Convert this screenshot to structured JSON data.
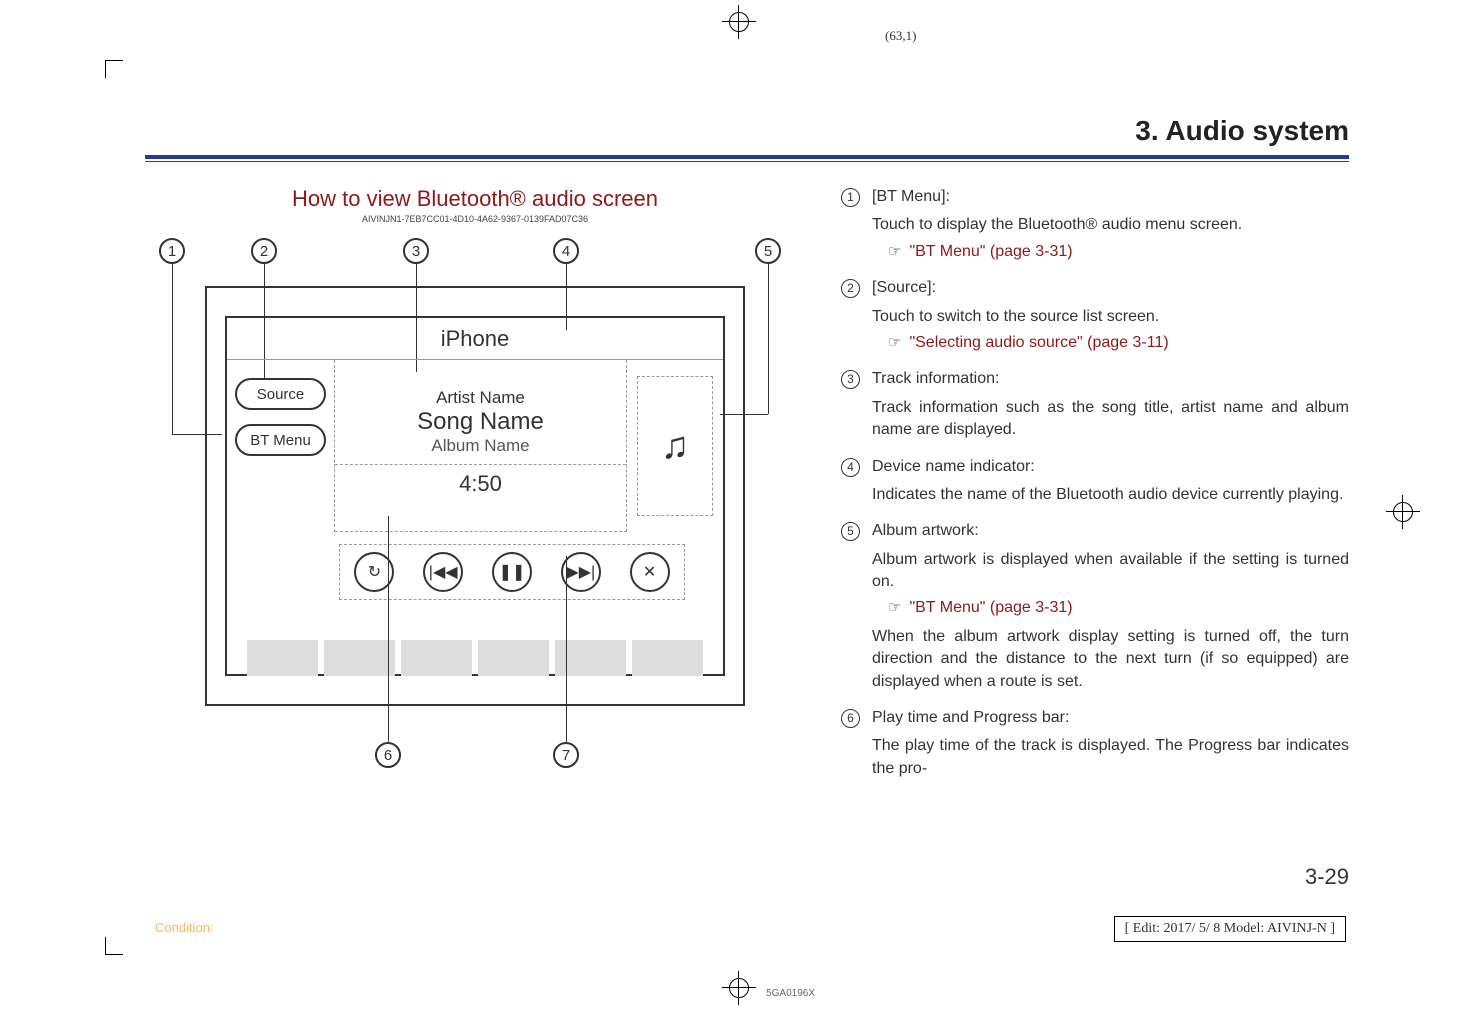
{
  "page_marker": "(63,1)",
  "chapter": "3. Audio system",
  "section_title": "How to view Bluetooth® audio screen",
  "guid": "AIVINJN1-7EB7CC01-4D10-4A62-9367-0139FAD07C36",
  "figure": {
    "device_name": "iPhone",
    "source_btn": "Source",
    "btmenu_btn": "BT Menu",
    "artist": "Artist Name",
    "song": "Song Name",
    "album": "Album Name",
    "time": "4:50",
    "callout_labels": [
      "1",
      "2",
      "3",
      "4",
      "5",
      "6",
      "7"
    ],
    "image_id": "5GA0196X"
  },
  "items": [
    {
      "num": "1",
      "title": "[BT Menu]:",
      "desc": "Touch to display the Bluetooth® audio menu screen.",
      "xref": "\"BT Menu\" (page 3-31)"
    },
    {
      "num": "2",
      "title": "[Source]:",
      "desc": "Touch to switch to the source list screen.",
      "xref": "\"Selecting audio source\" (page 3-11)"
    },
    {
      "num": "3",
      "title": "Track information:",
      "desc": "Track information such as the song title, artist name and album name are displayed."
    },
    {
      "num": "4",
      "title": "Device name indicator:",
      "desc": "Indicates the name of the Bluetooth audio device currently playing."
    },
    {
      "num": "5",
      "title": "Album artwork:",
      "desc": "Album artwork is displayed when available if the setting is turned on.",
      "xref": "\"BT Menu\" (page 3-31)",
      "desc2": "When the album artwork display setting is turned off, the turn direction and the distance to the next turn (if so equipped) are displayed when a route is set."
    },
    {
      "num": "6",
      "title": "Play time and Progress bar:",
      "desc": "The play time of the track is displayed. The Progress bar indicates the pro-"
    }
  ],
  "page_number": "3-29",
  "condition_label": "Condition:",
  "edit_info": "[ Edit: 2017/ 5/ 8    Model:  AIVINJ-N ]"
}
